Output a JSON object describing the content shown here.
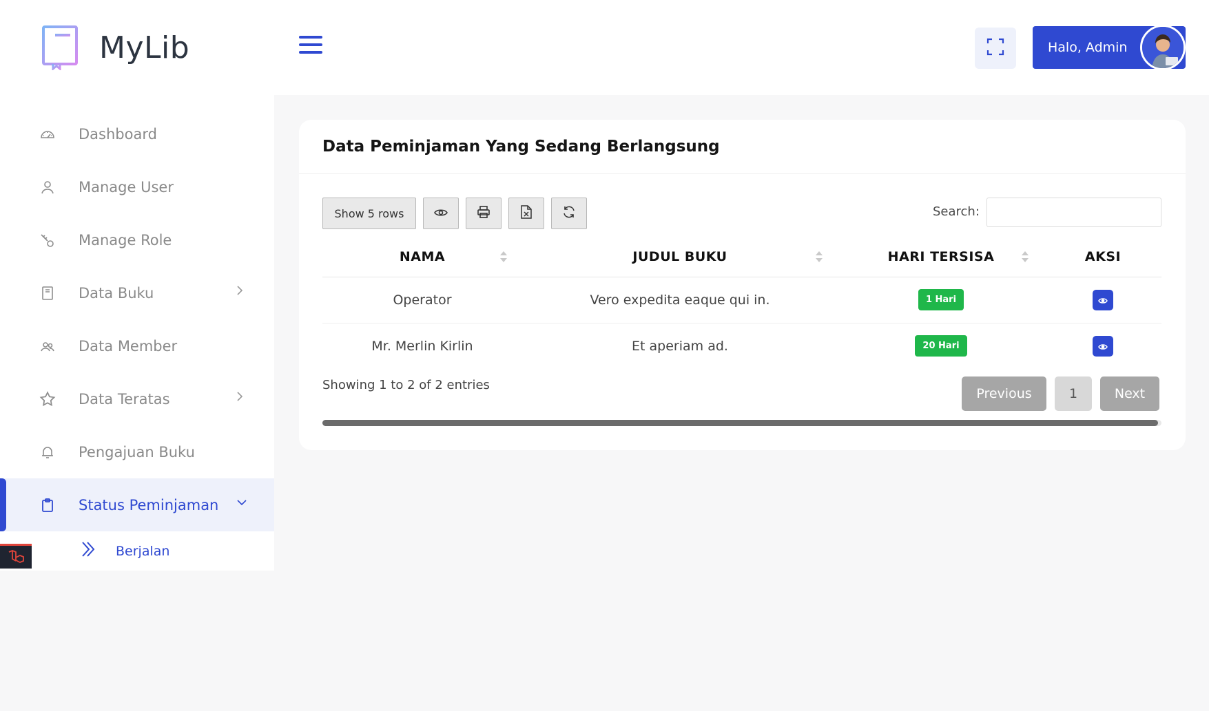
{
  "brand": {
    "name": "MyLib",
    "logo_icon": "book-logo-icon"
  },
  "sidebar": {
    "items": [
      {
        "label": "Dashboard",
        "icon": "dashboard-gauge-icon"
      },
      {
        "label": "Manage User",
        "icon": "user-icon"
      },
      {
        "label": "Manage Role",
        "icon": "key-icon"
      },
      {
        "label": "Data Buku",
        "icon": "book-icon",
        "has_submenu": true
      },
      {
        "label": "Data Member",
        "icon": "users-icon"
      },
      {
        "label": "Data Teratas",
        "icon": "star-icon",
        "has_submenu": true
      },
      {
        "label": "Pengajuan Buku",
        "icon": "bell-icon"
      },
      {
        "label": "Status Peminjaman",
        "icon": "clipboard-icon",
        "has_submenu": true,
        "active": true
      }
    ],
    "subitems": [
      {
        "label": "Berjalan",
        "icon": "double-chevron-right-icon"
      }
    ]
  },
  "topbar": {
    "user_greeting": "Halo, Admin",
    "fullscreen_icon": "fullscreen-icon",
    "menu_icon": "hamburger-menu-icon"
  },
  "card": {
    "title": "Data Peminjaman Yang Sedang Berlangsung",
    "toolbar": {
      "show_rows_label": "Show 5 rows",
      "buttons": [
        "column-visibility-icon",
        "print-icon",
        "excel-export-icon",
        "refresh-icon"
      ]
    },
    "search": {
      "label": "Search:",
      "value": "",
      "placeholder": ""
    },
    "columns": [
      "NAMA",
      "JUDUL BUKU",
      "HARI TERSISA",
      "AKSI"
    ],
    "rows": [
      {
        "nama": "Operator",
        "judul_buku": "Vero expedita eaque qui in.",
        "hari_tersisa": "1 Hari"
      },
      {
        "nama": "Mr. Merlin Kirlin",
        "judul_buku": "Et aperiam ad.",
        "hari_tersisa": "20 Hari"
      }
    ],
    "entries_info": "Showing 1 to 2 of 2 entries",
    "pagination": {
      "previous": "Previous",
      "current_page": "1",
      "next": "Next"
    }
  },
  "colors": {
    "primary": "#2f49d1",
    "badge_green": "#1fb74a",
    "pager_gray": "#a6a6a6",
    "sidebar_active_bg": "#eef1fb"
  }
}
